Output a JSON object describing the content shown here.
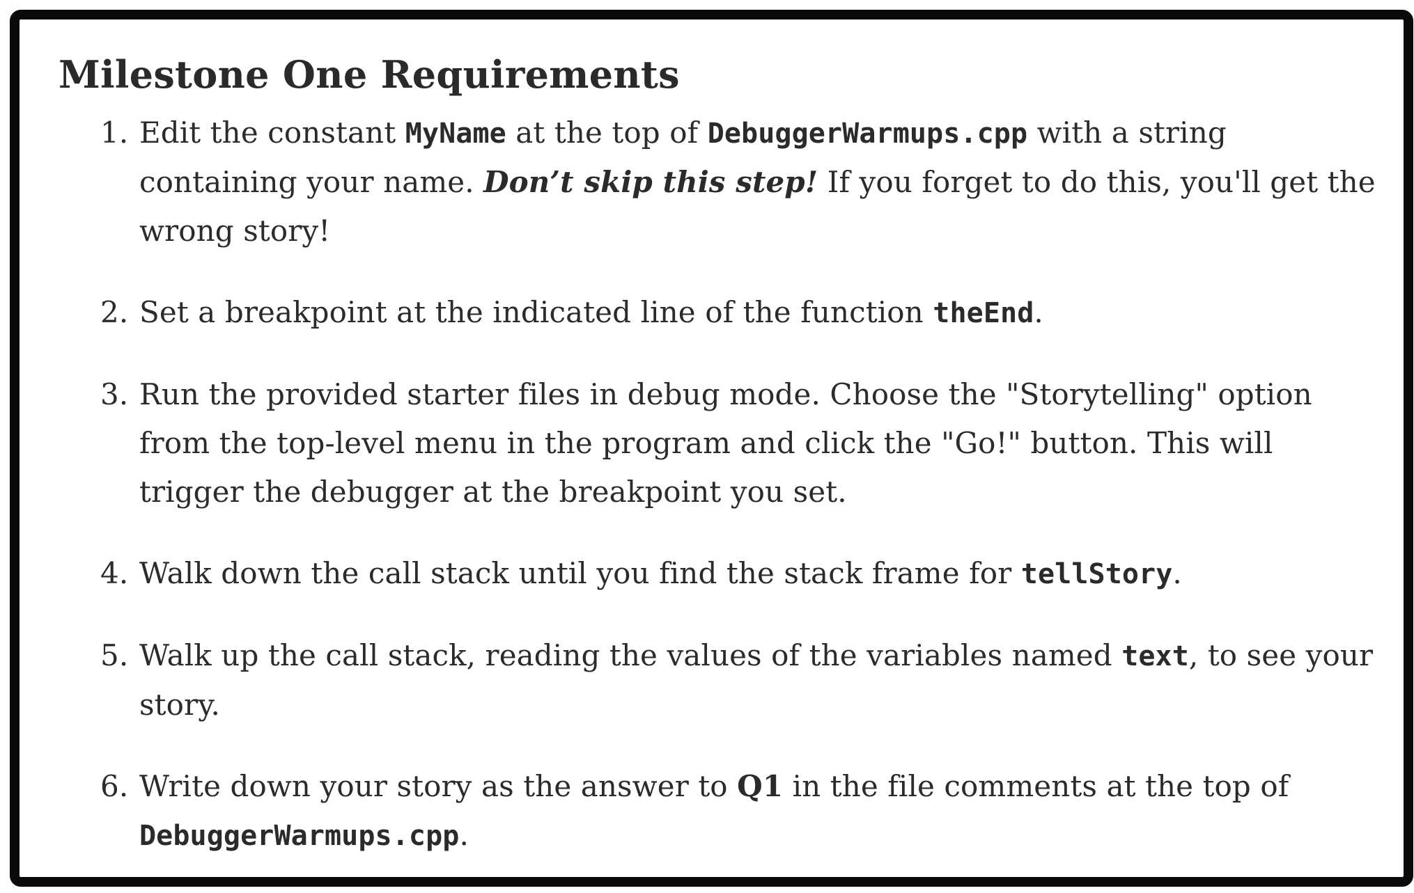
{
  "title": "Milestone One Requirements",
  "steps": [
    {
      "num": "1.",
      "parts": [
        {
          "text": "Edit the constant "
        },
        {
          "code": "MyName"
        },
        {
          "text": " at the top of "
        },
        {
          "code": "DebuggerWarmups.cpp"
        },
        {
          "text": " with a string containing your name. "
        },
        {
          "emph": "Don’t skip this step!"
        },
        {
          "text": " If you forget to do this, you'll get the wrong story!"
        }
      ]
    },
    {
      "num": "2.",
      "parts": [
        {
          "text": "Set a breakpoint at the indicated line of the function "
        },
        {
          "code": "theEnd"
        },
        {
          "text": "."
        }
      ]
    },
    {
      "num": "3.",
      "parts": [
        {
          "text": "Run the provided starter files in debug mode. Choose the \"Storytelling\" option from the top-level menu in the program and click the \"Go!\" button. This will trigger the debugger at the breakpoint you set."
        }
      ]
    },
    {
      "num": "4.",
      "parts": [
        {
          "text": "Walk down the call stack until you find the stack frame for "
        },
        {
          "code": "tellStory"
        },
        {
          "text": "."
        }
      ]
    },
    {
      "num": "5.",
      "parts": [
        {
          "text": "Walk up the call stack, reading the values of the variables named "
        },
        {
          "code": "text"
        },
        {
          "text": ", to see your story."
        }
      ]
    },
    {
      "num": "6.",
      "parts": [
        {
          "text": "Write down your story as the answer to "
        },
        {
          "bold": "Q1"
        },
        {
          "text": " in the file comments at the top of "
        },
        {
          "code": "DebuggerWarmups.cpp"
        },
        {
          "text": "."
        }
      ]
    }
  ]
}
